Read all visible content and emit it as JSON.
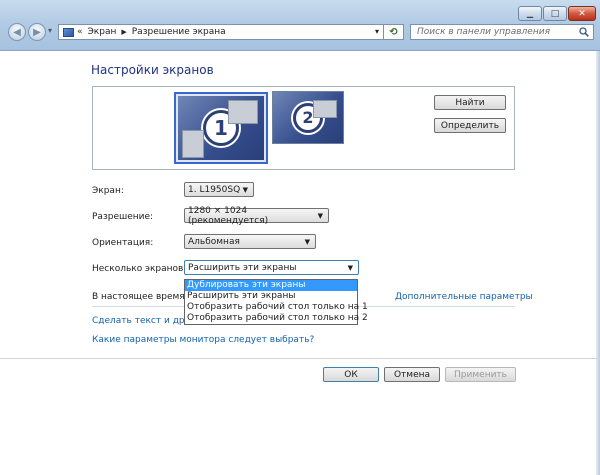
{
  "window": {
    "minimize_glyph": "▁",
    "maximize_glyph": "□",
    "close_glyph": "✕"
  },
  "navigation": {
    "back_glyph": "◀",
    "forward_glyph": "▶",
    "history_glyph": "▾",
    "breadcrumb_overflow": "«",
    "breadcrumb": [
      "Экран",
      "Разрешение экрана"
    ],
    "search_placeholder": "Поиск в панели управления"
  },
  "page": {
    "title": "Настройки экранов",
    "find_button": "Найти",
    "identify_button": "Определить",
    "monitor1_number": "1",
    "monitor2_number": "2"
  },
  "settings": {
    "display_label": "Экран:",
    "display_value": "1. L1950SQ",
    "resolution_label": "Разрешение:",
    "resolution_value": "1280 × 1024 (рекомендуется)",
    "orientation_label": "Ориентация:",
    "orientation_value": "Альбомная",
    "multiple_label": "Несколько экранов:",
    "multiple_value": "Расширить эти экраны",
    "multiple_options": [
      "Дублировать эти экраны",
      "Расширить эти экраны",
      "Отобразить рабочий стол только на 1",
      "Отобразить рабочий стол только на 2"
    ],
    "highlighted_option_index": 0
  },
  "info": {
    "current_text": "В настоящее время эт",
    "advanced_link": "Дополнительные параметры",
    "text_size_link": "Сделать текст и други",
    "monitor_help_link": "Какие параметры монитора следует выбрать?"
  },
  "footer": {
    "ok": "ОК",
    "cancel": "Отмена",
    "apply": "Применить"
  },
  "colors": {
    "title_blue": "#1e3287",
    "link_blue": "#1462ad",
    "selection_blue": "#3399ff"
  }
}
